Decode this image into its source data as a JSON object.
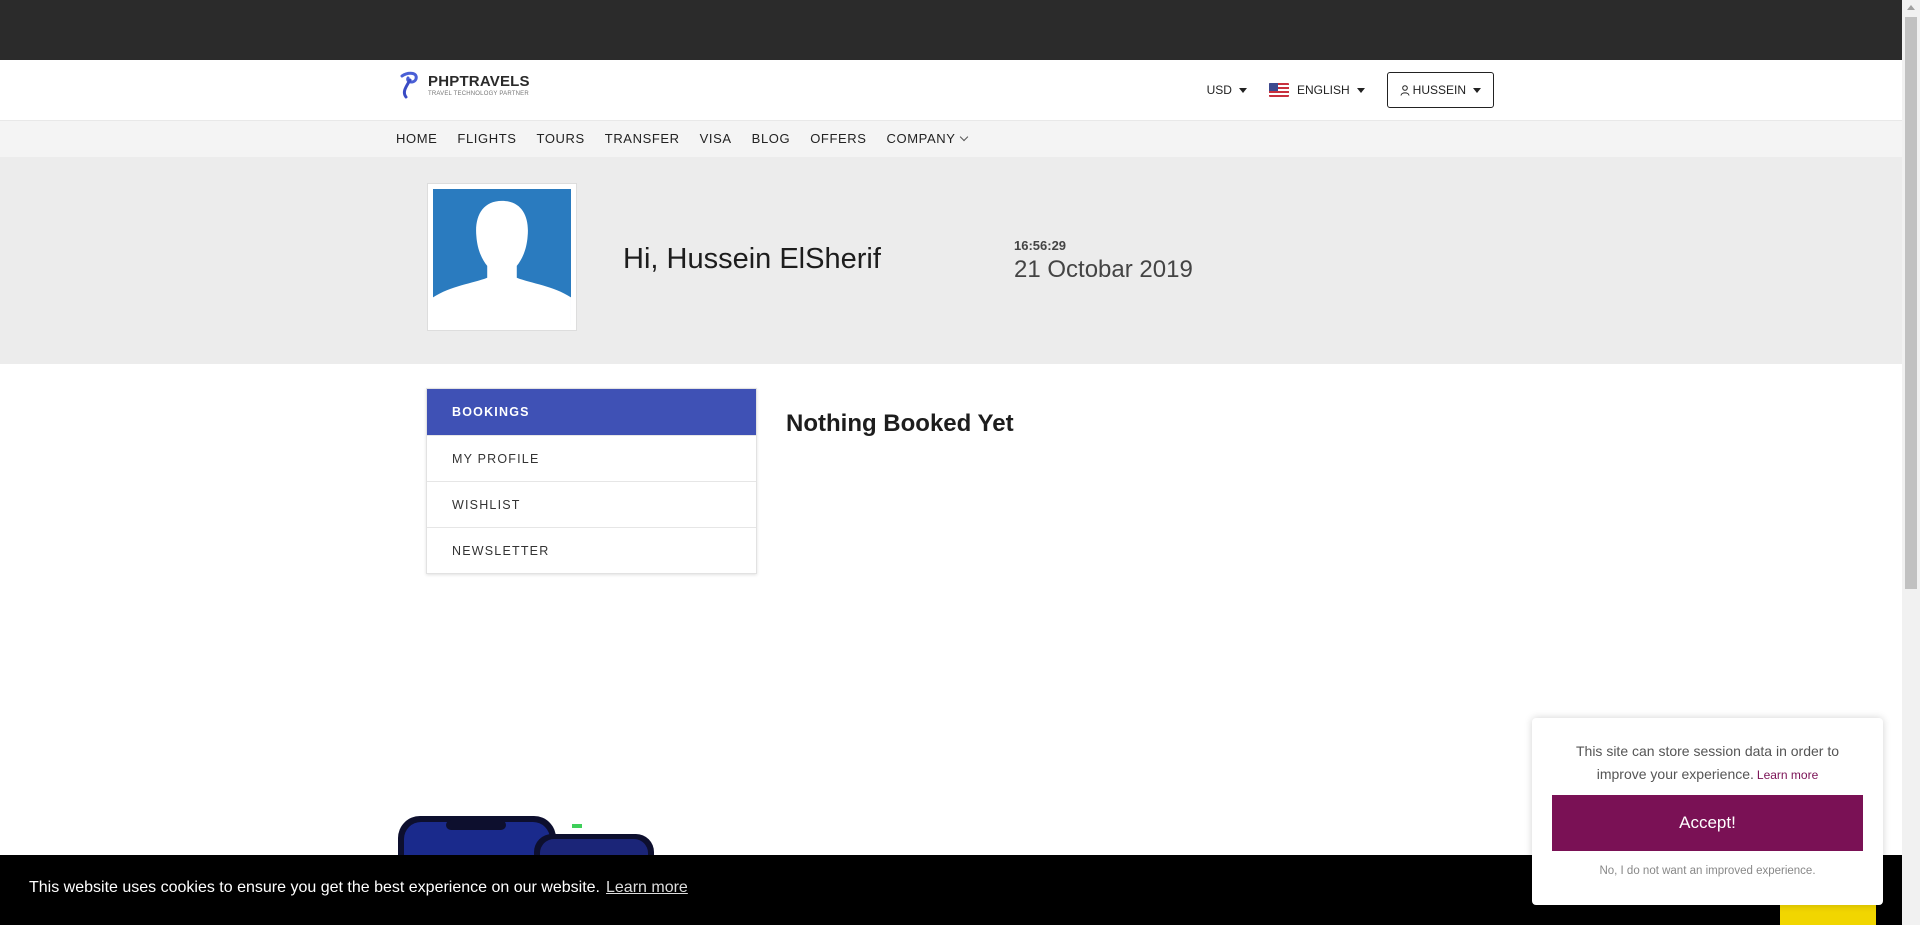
{
  "header": {
    "logo_name": "PHPTRAVELS",
    "logo_tagline": "TRAVEL TECHNOLOGY PARTNER",
    "currency": "USD",
    "language": "ENGLISH",
    "user": "HUSSEIN"
  },
  "nav": {
    "items": [
      "HOME",
      "FLIGHTS",
      "TOURS",
      "TRANSFER",
      "VISA",
      "BLOG",
      "OFFERS",
      "COMPANY"
    ]
  },
  "profile": {
    "greeting": "Hi, Hussein ElSherif",
    "time": "16:56:29",
    "date": "21 Octobar 2019"
  },
  "sidebar": {
    "items": [
      {
        "label": "BOOKINGS",
        "active": true
      },
      {
        "label": "MY PROFILE",
        "active": false
      },
      {
        "label": "WISHLIST",
        "active": false
      },
      {
        "label": "NEWSLETTER",
        "active": false
      }
    ]
  },
  "main": {
    "empty_message": "Nothing Booked Yet"
  },
  "cookie_bar": {
    "text": "This website uses cookies to ensure you get the best experience on our website.",
    "link": "Learn more"
  },
  "consent": {
    "message": "This site can store session data in order to improve your experience.",
    "learn_more": "Learn more",
    "accept": "Accept!",
    "decline": "No, I do not want an improved experience."
  },
  "colors": {
    "topbar": "#2b2b2b",
    "accent": "#3f51b5",
    "consent_button": "#7a1155",
    "avatar_bg": "#2a7bbf",
    "cookie_button": "#f1d600"
  }
}
